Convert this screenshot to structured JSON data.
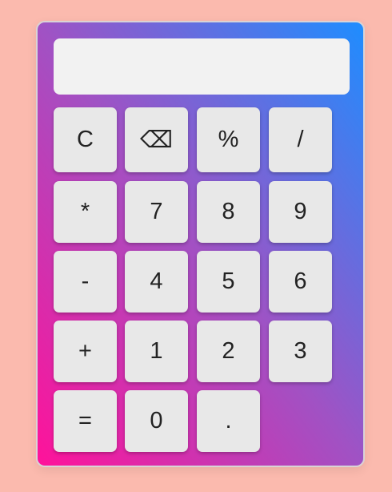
{
  "display": {
    "value": ""
  },
  "keys": {
    "clear": "C",
    "backspace": "⌫",
    "percent": "%",
    "divide": "/",
    "multiply": "*",
    "seven": "7",
    "eight": "8",
    "nine": "9",
    "minus": "-",
    "four": "4",
    "five": "5",
    "six": "6",
    "plus": "+",
    "one": "1",
    "two": "2",
    "three": "3",
    "equals": "=",
    "zero": "0",
    "decimal": "."
  },
  "colors": {
    "page_background": "#fbbaae",
    "gradient_start": "#ff129a",
    "gradient_mid": "#a052c4",
    "gradient_end": "#1e8dff",
    "key_background": "#e8e8e8",
    "display_background": "#f2f2f2"
  }
}
